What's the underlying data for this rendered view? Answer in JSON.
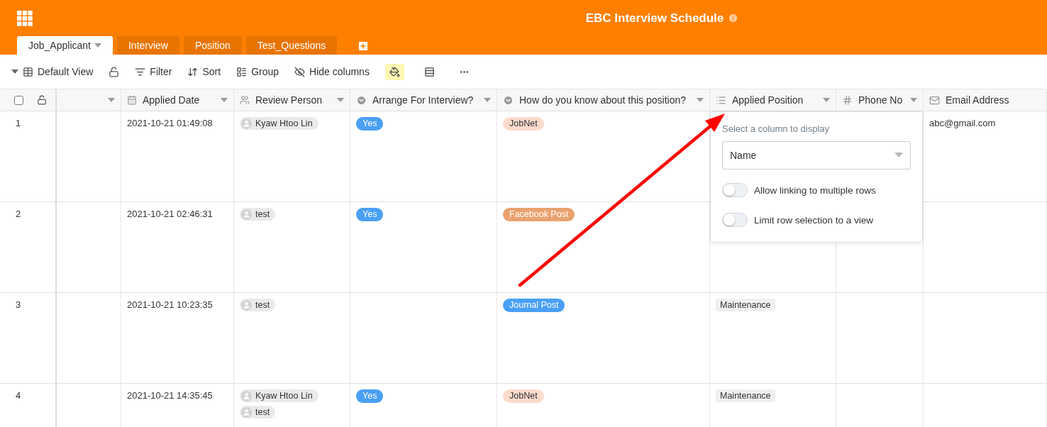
{
  "app": {
    "title": "EBC Interview Schedule"
  },
  "tabs": [
    {
      "label": "Job_Applicant",
      "selected": true
    },
    {
      "label": "Interview",
      "selected": false
    },
    {
      "label": "Position",
      "selected": false
    },
    {
      "label": "Test_Questions",
      "selected": false
    }
  ],
  "toolbar": {
    "view": "Default View",
    "buttons": [
      {
        "kind": "filter",
        "label": "Filter"
      },
      {
        "kind": "sort",
        "label": "Sort"
      },
      {
        "kind": "group",
        "label": "Group"
      },
      {
        "kind": "hide",
        "label": "Hide columns"
      },
      {
        "kind": "color",
        "active": true
      },
      {
        "kind": "height",
        "active": false
      },
      {
        "kind": "more",
        "active": false
      }
    ]
  },
  "table": {
    "select_all": {
      "checked": false
    },
    "columns": [
      {
        "kind": "cut"
      },
      {
        "kind": "date",
        "label": "Applied Date"
      },
      {
        "kind": "person",
        "label": "Review Person"
      },
      {
        "kind": "arrange",
        "label": "Arrange For Interview?"
      },
      {
        "kind": "source",
        "label": "How do you know about this position?"
      },
      {
        "kind": "link",
        "label": "Applied Position"
      },
      {
        "kind": "number",
        "label": "Phone No"
      },
      {
        "kind": "email",
        "label": "Email Address"
      }
    ],
    "rows": [
      {
        "number": "1",
        "date": "2021-10-21 01:49:08",
        "person": [
          "Kyaw Htoo Lin"
        ],
        "arrange": {
          "label": "Yes",
          "color": "#4aa0f5"
        },
        "source": {
          "label": "JobNet",
          "color": "#fddccd"
        },
        "email": "abc@gmail.com"
      },
      {
        "number": "2",
        "date": "2021-10-21 02:46:31",
        "person": [
          "test"
        ],
        "arrange": {
          "label": "Yes",
          "color": "#4aa0f5"
        },
        "source": {
          "label": "Facebook Post",
          "color": "#e9a26f"
        }
      },
      {
        "number": "3",
        "date": "2021-10-21 10:23:35",
        "person": [
          "test"
        ],
        "source": {
          "label": "Journal Post",
          "color": "#4aa0f5"
        },
        "link": [
          "Maintenance"
        ]
      },
      {
        "number": "4",
        "date": "2021-10-21 14:35:45",
        "person": [
          "Kyaw Htoo Lin",
          "test"
        ],
        "arrange": {
          "label": "Yes",
          "color": "#4aa0f5"
        },
        "source": {
          "label": "JobNet",
          "color": "#fddccd"
        },
        "link": [
          "Maintenance"
        ]
      }
    ]
  },
  "popover": {
    "label": "Select a column to display",
    "select_value": "Name",
    "toggles": [
      {
        "label": "Allow linking to multiple rows",
        "on": false
      },
      {
        "label": "Limit row selection to a view",
        "on": false
      }
    ]
  }
}
